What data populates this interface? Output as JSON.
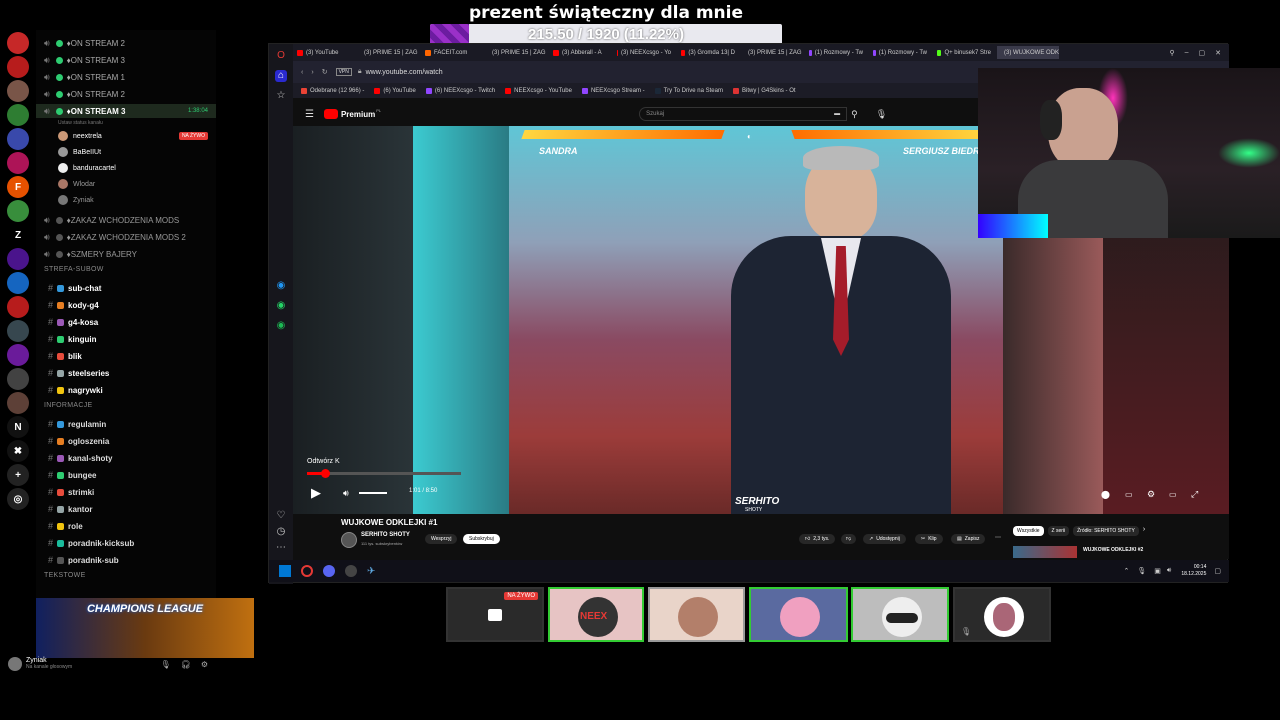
{
  "banner": {
    "title": "prezent świąteczny dla mnie",
    "progress_text": "215.50 / 1920 (11.22%)",
    "progress_fraction": 0.1122,
    "fill_color": "#9a30c8"
  },
  "discord": {
    "server_rail": [
      {
        "icon": "red-bowl-icon",
        "color": "#c62828",
        "label": ""
      },
      {
        "icon": "santa-icon",
        "color": "#b71c1c",
        "label": ""
      },
      {
        "icon": "face-icon",
        "color": "#795548",
        "label": ""
      },
      {
        "icon": "green-circle-icon",
        "color": "#2e7d32",
        "label": ""
      },
      {
        "icon": "figure-icon",
        "color": "#3949ab",
        "label": ""
      },
      {
        "icon": "rose-icon",
        "color": "#ad1457",
        "label": ""
      },
      {
        "icon": "letter-f-icon",
        "color": "#e65100",
        "label": "F"
      },
      {
        "icon": "colorful-icon",
        "color": "#388e3c",
        "label": ""
      },
      {
        "icon": "letter-z-icon",
        "color": "#000",
        "label": "Z"
      },
      {
        "icon": "gamer-icon",
        "color": "#4a148c",
        "label": ""
      },
      {
        "icon": "blue-square-icon",
        "color": "#1565c0",
        "label": ""
      },
      {
        "icon": "red-logo-icon",
        "color": "#b71c1c",
        "label": ""
      },
      {
        "icon": "car-icon",
        "color": "#37474f",
        "label": ""
      },
      {
        "icon": "clan-icon",
        "color": "#6a1b9a",
        "label": ""
      },
      {
        "icon": "shot-icon",
        "color": "#424242",
        "label": ""
      },
      {
        "icon": "game-icon",
        "color": "#5d4037",
        "label": ""
      },
      {
        "icon": "letter-n-icon",
        "color": "#111",
        "label": "N"
      },
      {
        "icon": "cross-icon",
        "color": "#111",
        "label": "✖"
      },
      {
        "icon": "plus-icon",
        "color": "#222",
        "label": "+"
      },
      {
        "icon": "compass-icon",
        "color": "#222",
        "label": "◎"
      }
    ],
    "voice_channels": [
      {
        "name": "♦ON STREAM 2",
        "active": false
      },
      {
        "name": "♦ON STREAM 3",
        "active": false
      },
      {
        "name": "♦ON STREAM 1",
        "active": false
      },
      {
        "name": "♦ON STREAM 2",
        "active": false
      },
      {
        "name": "♦ON STREAM 3",
        "active": true,
        "time": "1:38:04",
        "status": "Ustaw status kanału"
      }
    ],
    "voice_users": [
      {
        "name": "neextrela",
        "live": "NA ŻYWO"
      },
      {
        "name": "BaBeIIUt",
        "live": ""
      },
      {
        "name": "banduracartel",
        "live": ""
      },
      {
        "name": "Wlodar",
        "live": ""
      },
      {
        "name": "Zyniak",
        "live": ""
      }
    ],
    "locked_channels": [
      "♦ZAKAZ WCHODZENIA MODS",
      "♦ZAKAZ WCHODZENIA MODS 2",
      "♦SZMERY BAJERY"
    ],
    "category_subs": "STREFA-SUBOW",
    "sub_channels": [
      "sub-chat",
      "kody-g4",
      "g4-kosa",
      "kinguin",
      "blik",
      "steelseries",
      "nagrywki"
    ],
    "category_info": "INFORMACJE",
    "info_channels": [
      "regulamin",
      "ogloszenia",
      "kanal-shoty",
      "bungee",
      "strimki",
      "kantor",
      "role",
      "poradnik-kicksub",
      "poradnik-sub"
    ],
    "category_text": "TEKSTOWE",
    "user_panel": {
      "name": "Zyniak",
      "status": "Na kanale głosowym"
    },
    "banner_art": "CHAMPIONS LEAGUE"
  },
  "browser": {
    "tabs": [
      "(3) YouTube",
      "(3) PRIME 15 | ZAG",
      "FACEIT.com",
      "(3) PRIME 15 | ZAG",
      "(3) Abberall - A",
      "(3) NEEXcsgo - Yo",
      "(3) Gromda 13| D",
      "(3) PRIME 15 | ZAG",
      "(1) Rozmowy - Tw",
      "(1) Rozmowy - Tw",
      "Q+ binusek7 Stre",
      "(3) WUJKOWE ODKLE"
    ],
    "url": "www.youtube.com/watch",
    "vpn": "VPN",
    "bookmarks": [
      "Odebrane (12 966) -",
      "(6) YouTube",
      "(6) NEEXcsgo - Twitch",
      "NEEXcsgo - YouTube",
      "NEEXcsgo Stream -",
      "Try To Drive na Steam",
      "Bitwy | G4Skins - Ot"
    ],
    "yt_logo": "Premium",
    "yt_region": "PL",
    "search_placeholder": "Szukaj",
    "video": {
      "left_name": "SANDRA",
      "right_name": "SERGIUSZ BIEDR",
      "tooltip": "Odtwórz  K",
      "time": "1:01 / 8:50",
      "progress": 0.115,
      "watermark": "SERHITO",
      "watermark_sub": "SHOTY"
    },
    "info": {
      "title": "WUJKOWE ODKLEJKI #1",
      "channel": "SERHITO SHOTY",
      "subs": "111 tys. subskrybentów",
      "support": "Wesprzyj",
      "subscribe": "Subskrybuj",
      "likes": "2,3 tys.",
      "share": "Udostępnij",
      "clip": "Klip",
      "save": "Zapisz",
      "chips": [
        "Wszystkie",
        "Z serii",
        "Źródło: SERHITO SHOTY"
      ],
      "next_title": "WUJKOWE ODKLEJKI #2"
    },
    "taskbar": {
      "time": "00:14",
      "date": "18.12.2025"
    }
  },
  "bottom": {
    "live_badge": "NA ŻYWO",
    "labels": [
      "NEEX"
    ]
  }
}
